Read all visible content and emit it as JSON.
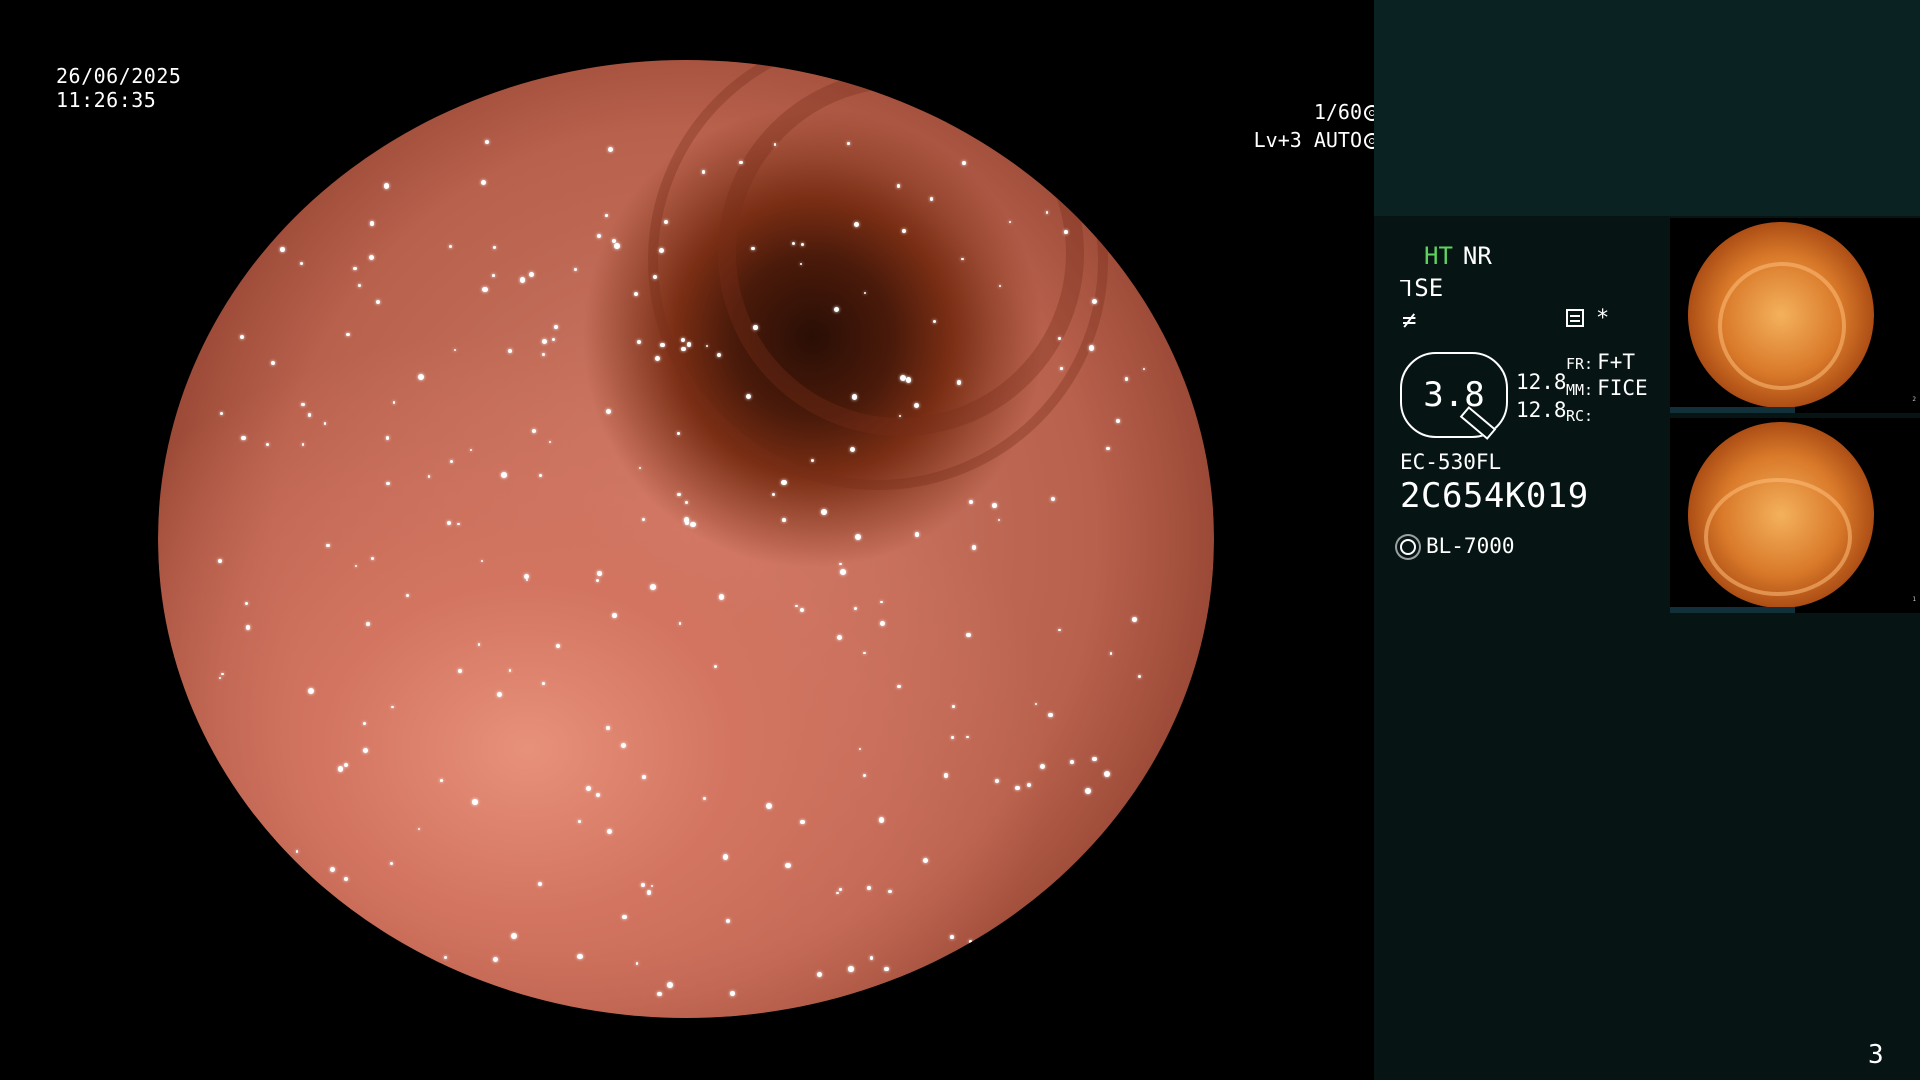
{
  "overlay": {
    "date": "26/06/2025",
    "time": "11:26:35",
    "shutter": "1/60",
    "iris": "Lv+3 AUTO"
  },
  "panel": {
    "mode_ht": "HT",
    "mode_nr": "NR",
    "se_label": "SE",
    "se_symbol": "⅂",
    "enhance_symbol": "≠",
    "asterisk": "*",
    "zoom": "3.8",
    "value1": "12.8",
    "value2": "12.8",
    "fr_key": "FR:",
    "fr_val": "F+T",
    "mm_key": "MM:",
    "mm_val": "FICE",
    "rc_key": "RC:",
    "rc_val": "",
    "scope_model": "EC-530FL",
    "scope_serial": "2C654K019",
    "light_source": "BL-7000"
  },
  "thumbnails": [
    {
      "index": "2"
    },
    {
      "index": "1"
    }
  ],
  "page_number": "3",
  "colors": {
    "ht_green": "#5fd35f",
    "panel_top": "#0b2222",
    "panel_bottom": "#061414"
  }
}
